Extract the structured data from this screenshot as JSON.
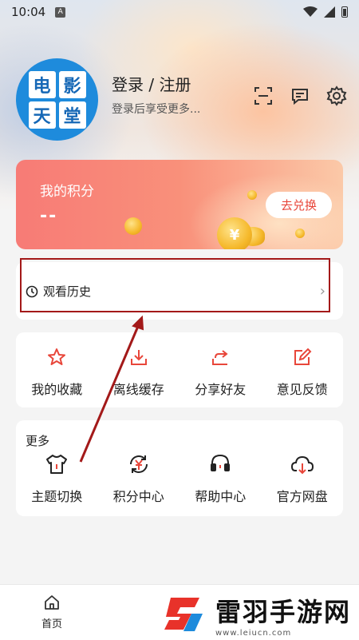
{
  "status_bar": {
    "time": "10:04",
    "notification_glyph": "A"
  },
  "profile": {
    "avatar_text": [
      "电",
      "影",
      "天",
      "堂"
    ],
    "login_title": "登录 / 注册",
    "login_subtitle": "登录后享受更多..."
  },
  "top_icons": [
    "scan-icon",
    "message-icon",
    "settings-icon"
  ],
  "points": {
    "title": "我的积分",
    "value": "--",
    "exchange_label": "去兑换",
    "coin_glyph": "¥"
  },
  "history": {
    "label": "观看历史"
  },
  "quick_actions": [
    {
      "label": "我的收藏",
      "icon": "star-icon"
    },
    {
      "label": "离线缓存",
      "icon": "download-icon"
    },
    {
      "label": "分享好友",
      "icon": "share-icon"
    },
    {
      "label": "意见反馈",
      "icon": "feedback-icon"
    }
  ],
  "more": {
    "title": "更多",
    "items": [
      {
        "label": "主题切换",
        "icon": "shirt-icon"
      },
      {
        "label": "积分中心",
        "icon": "points-icon"
      },
      {
        "label": "帮助中心",
        "icon": "headset-icon"
      },
      {
        "label": "官方网盘",
        "icon": "cloud-icon"
      }
    ]
  },
  "bottom_nav": {
    "home_label": "首页"
  },
  "watermark": {
    "title": "雷羽手游网",
    "url": "www.leiucn.com"
  },
  "colors": {
    "accent": "#e8463a",
    "annotation": "#a31919",
    "avatar_bg": "#1e8bdc"
  }
}
